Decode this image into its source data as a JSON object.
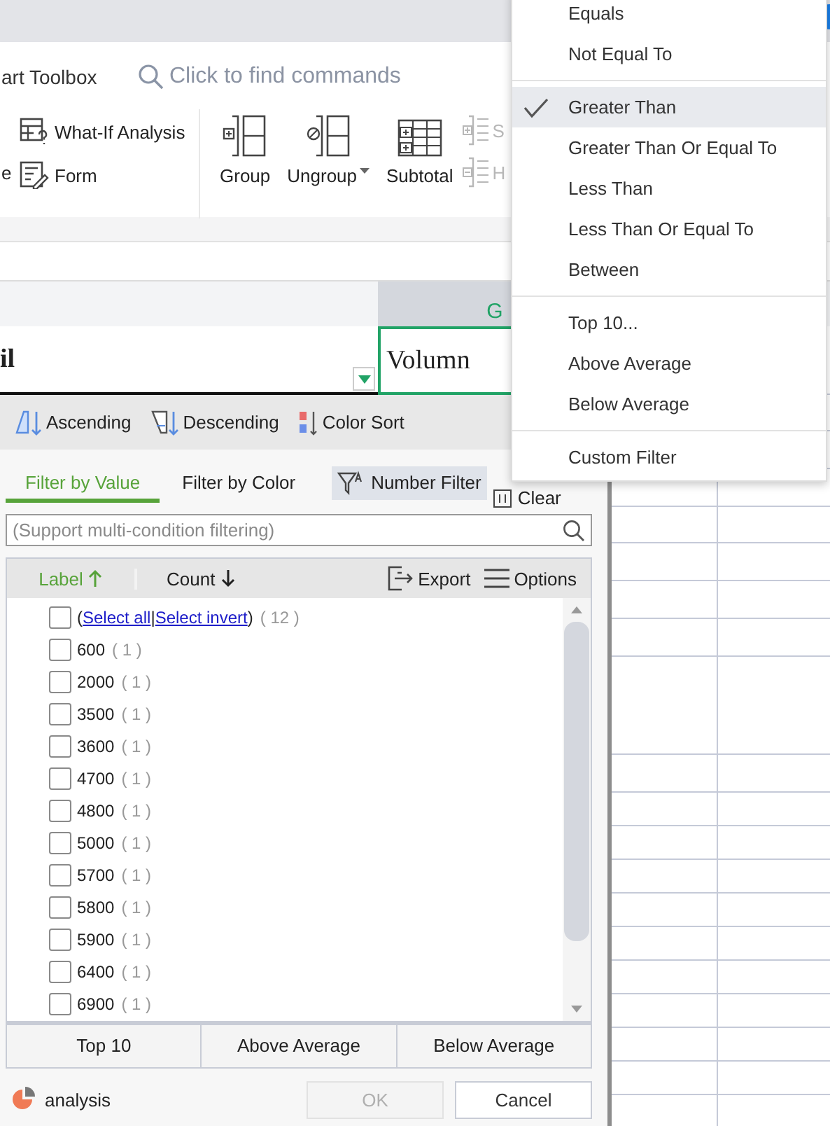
{
  "ribbon": {
    "left_tab": "art Toolbox",
    "command_search": {
      "placeholder": "Click to find commands"
    },
    "cut_label": "e",
    "small_tools": [
      {
        "label": "What-If Analysis",
        "kind": "whatif"
      },
      {
        "label": "Form",
        "kind": "form"
      }
    ],
    "large_tools": [
      {
        "label": "Group",
        "kind": "group",
        "has_menu": false
      },
      {
        "label": "Ungroup",
        "kind": "ungroup",
        "has_menu": true
      },
      {
        "label": "Subtotal",
        "kind": "subtotal",
        "has_menu": false
      }
    ],
    "side_tools": [
      {
        "label": "S",
        "kind": "show",
        "disabled": true
      },
      {
        "label": "H",
        "kind": "hide",
        "disabled": true
      }
    ]
  },
  "sheet": {
    "column_header": "G",
    "header_cells": [
      {
        "text": "il",
        "selected": false,
        "filter": true
      },
      {
        "text": "Volumn",
        "selected": true
      }
    ]
  },
  "filter_panel": {
    "sort": [
      {
        "label": "Ascending",
        "kind": "asc"
      },
      {
        "label": "Descending",
        "kind": "desc"
      },
      {
        "label": "Color Sort",
        "kind": "color"
      }
    ],
    "tabs": [
      {
        "label": "Filter by Value",
        "selected": true
      },
      {
        "label": "Filter by Color",
        "selected": false
      }
    ],
    "number_filter": {
      "label": "Number Filter",
      "active": true
    },
    "clear": "Clear",
    "search": {
      "placeholder": "(Support multi-condition filtering)"
    },
    "columns": [
      {
        "label": "Label",
        "kind": "ascending",
        "selected": true
      },
      {
        "label": "Count",
        "kind": "descending",
        "selected": false
      }
    ],
    "actions": [
      {
        "label": "Export",
        "kind": "export"
      },
      {
        "label": "Options",
        "kind": "options"
      }
    ],
    "select_all": {
      "checked": false,
      "open": "(",
      "links": [
        "Select all",
        "Select invert"
      ],
      "separator": "|",
      "close": ")",
      "count": "( 12 )"
    },
    "items": [
      {
        "value": "600",
        "count": "( 1 )",
        "checked": false
      },
      {
        "value": "2000",
        "count": "( 1 )",
        "checked": false
      },
      {
        "value": "3500",
        "count": "( 1 )",
        "checked": false
      },
      {
        "value": "3600",
        "count": "( 1 )",
        "checked": false
      },
      {
        "value": "4700",
        "count": "( 1 )",
        "checked": false
      },
      {
        "value": "4800",
        "count": "( 1 )",
        "checked": false
      },
      {
        "value": "5000",
        "count": "( 1 )",
        "checked": false
      },
      {
        "value": "5700",
        "count": "( 1 )",
        "checked": false
      },
      {
        "value": "5800",
        "count": "( 1 )",
        "checked": false
      },
      {
        "value": "5900",
        "count": "( 1 )",
        "checked": false
      },
      {
        "value": "6400",
        "count": "( 1 )",
        "checked": false
      },
      {
        "value": "6900",
        "count": "( 1 )",
        "checked": false
      }
    ],
    "quick": [
      "Top 10",
      "Above Average",
      "Below Average"
    ],
    "analysis": "analysis",
    "buttons": [
      {
        "label": "OK",
        "disabled": true
      },
      {
        "label": "Cancel",
        "disabled": false
      }
    ]
  },
  "menu": {
    "groups": [
      [
        {
          "label": "Equals",
          "selected": false
        },
        {
          "label": "Not Equal To",
          "selected": false
        }
      ],
      [
        {
          "label": "Greater Than",
          "selected": true
        },
        {
          "label": "Greater Than Or Equal To",
          "selected": false
        },
        {
          "label": "Less Than",
          "selected": false
        },
        {
          "label": "Less Than Or Equal To",
          "selected": false
        },
        {
          "label": "Between",
          "selected": false
        }
      ],
      [
        {
          "label": "Top 10...",
          "selected": false
        },
        {
          "label": "Above Average",
          "selected": false
        },
        {
          "label": "Below Average",
          "selected": false
        }
      ],
      [
        {
          "label": "Custom Filter",
          "selected": false
        }
      ]
    ]
  }
}
